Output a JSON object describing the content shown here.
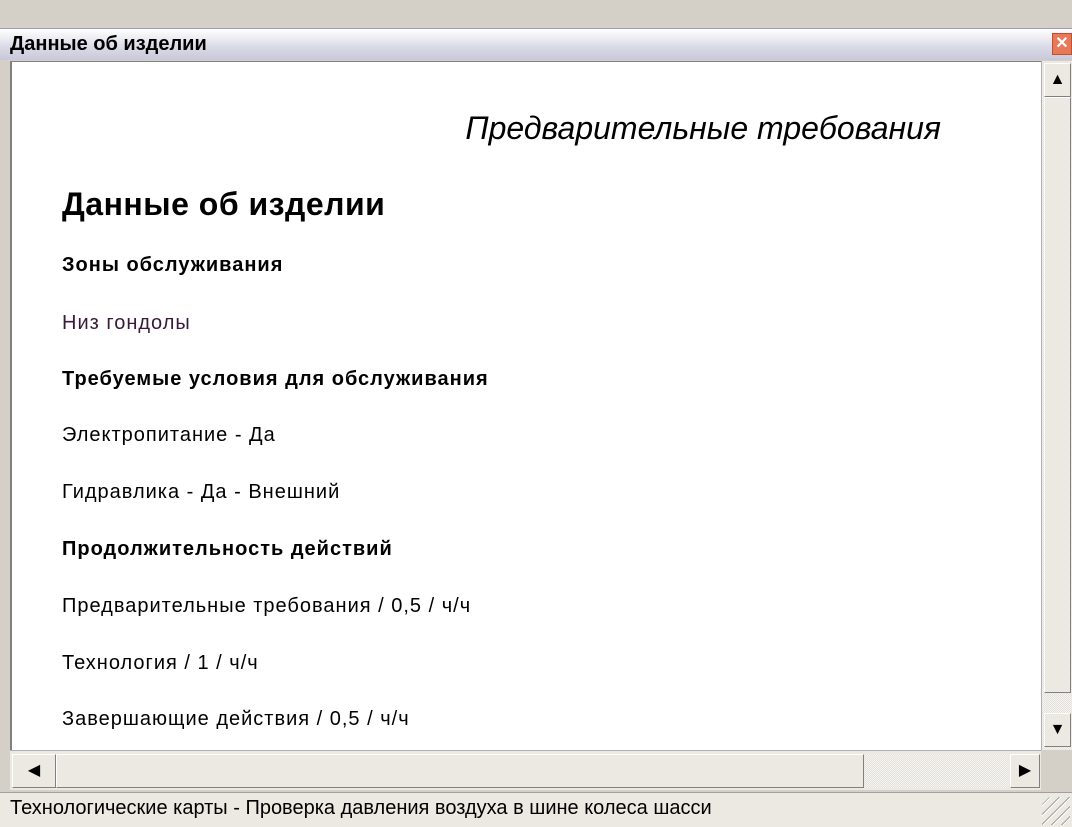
{
  "window": {
    "title": "Данные об изделии"
  },
  "document": {
    "section_title": "Предварительные требования",
    "heading": "Данные об изделии",
    "rows": [
      {
        "text": "Зоны обслуживания",
        "style": "bold"
      },
      {
        "text": "Низ гондолы",
        "style": "purple"
      },
      {
        "text": "Требуемые условия для обслуживания",
        "style": "bold"
      },
      {
        "text": "Электропитание - Да",
        "style": "normal"
      },
      {
        "text": "Гидравлика - Да - Внешний",
        "style": "normal"
      },
      {
        "text": "Продолжительность действий",
        "style": "bold"
      },
      {
        "text": "Предварительные требования / 0,5 / ч/ч",
        "style": "normal"
      },
      {
        "text": "Технология / 1 / ч/ч",
        "style": "normal"
      },
      {
        "text": "Завершающие действия / 0,5 / ч/ч",
        "style": "normal"
      }
    ]
  },
  "statusbar": {
    "text": "Технологические карты - Проверка давления воздуха в шине колеса шасси"
  },
  "icons": {
    "close": "close-icon",
    "scroll_up": "arrow-up-icon",
    "scroll_down": "arrow-down-icon",
    "scroll_left": "arrow-left-icon",
    "scroll_right": "arrow-right-icon"
  },
  "colors": {
    "close_button": "#e8785a",
    "content_background": "#ffffff"
  }
}
